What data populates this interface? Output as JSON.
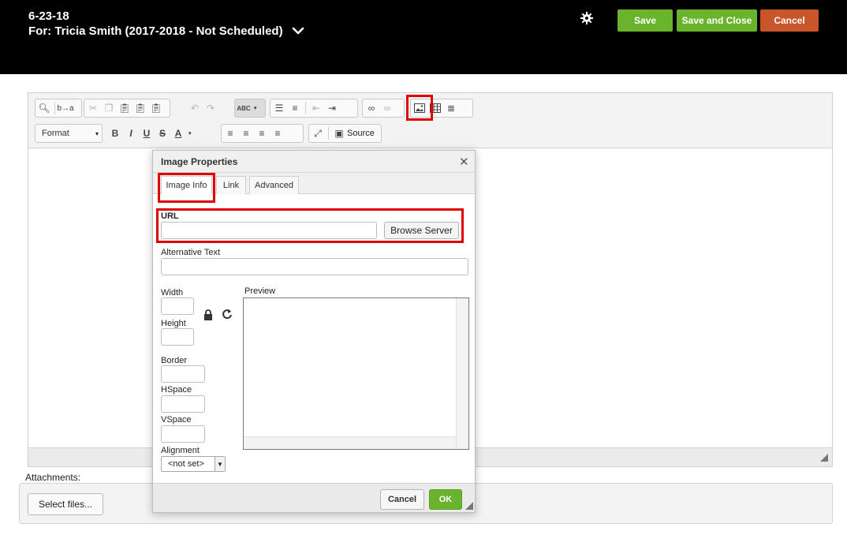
{
  "header": {
    "title": "6-23-18",
    "subtitle": "For: Tricia Smith (2017-2018 - Not Scheduled)",
    "save_label": "Save",
    "save_close_label": "Save and Close",
    "cancel_label": "Cancel",
    "colors": {
      "bg": "#000000",
      "save": "#6ab42d",
      "cancel": "#c9552a"
    }
  },
  "toolbar": {
    "row1_icons": [
      "find-icon",
      "replace-icon",
      "cut-icon",
      "copy-icon",
      "paste-icon",
      "paste-text-icon",
      "paste-word-icon",
      "undo-icon",
      "redo-icon",
      "spellcheck-icon",
      "numbered-list-icon",
      "bulleted-list-icon",
      "outdent-icon",
      "indent-icon",
      "link-icon",
      "unlink-icon",
      "image-icon",
      "table-icon",
      "horizontal-line-icon"
    ],
    "format_label": "Format",
    "row2_text": {
      "bold": "B",
      "italic": "I",
      "underline": "U",
      "strike": "S",
      "font_color": "A"
    },
    "source_label": "Source"
  },
  "attachments": {
    "label": "Attachments:",
    "select_files_label": "Select files..."
  },
  "dialog": {
    "title": "Image Properties",
    "close_glyph": "✕",
    "tabs": [
      {
        "label": "Image Info",
        "active": true
      },
      {
        "label": "Link",
        "active": false
      },
      {
        "label": "Advanced",
        "active": false
      }
    ],
    "url_label": "URL",
    "url_value": "",
    "browse_label": "Browse Server",
    "alt_label": "Alternative Text",
    "alt_value": "",
    "width_label": "Width",
    "height_label": "Height",
    "border_label": "Border",
    "hspace_label": "HSpace",
    "vspace_label": "VSpace",
    "alignment_label": "Alignment",
    "alignment_value": "<not set>",
    "preview_label": "Preview",
    "cancel_label": "Cancel",
    "ok_label": "OK"
  },
  "highlight_color": "#e10000"
}
